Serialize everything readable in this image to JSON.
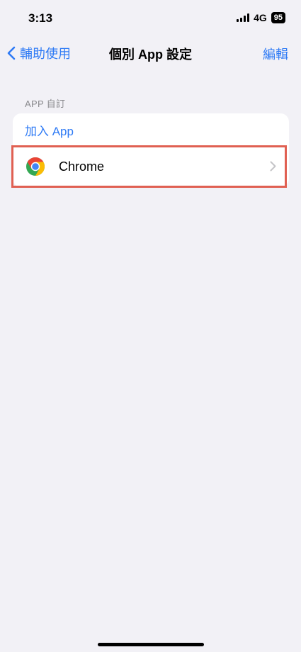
{
  "status": {
    "time": "3:13",
    "network": "4G",
    "battery": "95"
  },
  "nav": {
    "back_label": "輔助使用",
    "title": "個別 App 設定",
    "edit_label": "編輯"
  },
  "section": {
    "header": "APP 自訂",
    "add_label": "加入 App",
    "items": [
      {
        "label": "Chrome",
        "icon": "chrome-icon"
      }
    ]
  },
  "colors": {
    "accent": "#2f7bf5",
    "background": "#f2f1f6",
    "highlight": "#e06052"
  }
}
